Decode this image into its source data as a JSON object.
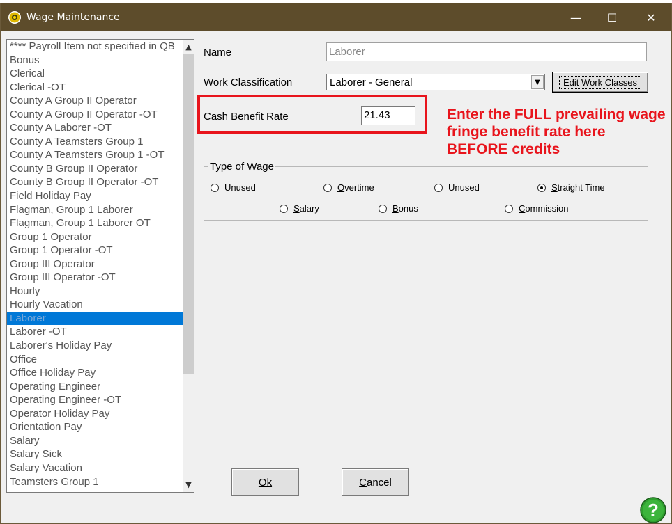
{
  "window": {
    "title": "Wage Maintenance",
    "controls": {
      "minimize": "—",
      "maximize": "☐",
      "close": "✕"
    }
  },
  "payroll_list": {
    "items": [
      "**** Payroll Item not specified in QB",
      "Bonus",
      "Clerical",
      "Clerical -OT",
      "County A Group II Operator",
      "County A Group II Operator -OT",
      "County A Laborer -OT",
      "County A Teamsters Group 1",
      "County A Teamsters Group 1 -OT",
      "County B Group II Operator",
      "County B Group II Operator -OT",
      "Field Holiday Pay",
      "Flagman, Group 1 Laborer",
      "Flagman, Group 1 Laborer OT",
      "Group 1 Operator",
      "Group 1 Operator -OT",
      "Group III Operator",
      "Group III Operator -OT",
      "Hourly",
      "Hourly Vacation",
      "Laborer",
      "Laborer -OT",
      "Laborer's Holiday Pay",
      "Office",
      "Office Holiday Pay",
      "Operating Engineer",
      "Operating Engineer -OT",
      "Operator Holiday Pay",
      "Orientation Pay",
      "Salary",
      "Salary Sick",
      "Salary Vacation",
      "Teamsters Group 1"
    ],
    "selected_index": 20,
    "scroll_up": "▲",
    "scroll_down": "▼"
  },
  "form": {
    "name_label": "Name",
    "name_value": "Laborer",
    "work_class_label": "Work Classification",
    "work_class_value": "Laborer - General",
    "dropdown_arrow": "▼",
    "edit_work_classes": "Edit Work Classes",
    "cash_benefit_label": "Cash Benefit Rate",
    "cash_benefit_value": "21.43"
  },
  "annotation": {
    "text": "Enter the FULL prevailing wage fringe benefit rate here BEFORE credits",
    "color": "#e8141c"
  },
  "type_of_wage": {
    "title": "Type of Wage",
    "options": {
      "unused1": {
        "label": "Unused",
        "checked": false
      },
      "overtime": {
        "label": "Overtime",
        "checked": false
      },
      "unused2": {
        "label": "Unused",
        "checked": false
      },
      "straight_time": {
        "label": "Straight Time",
        "checked": true
      },
      "salary": {
        "label": "Salary",
        "checked": false
      },
      "bonus": {
        "label": "Bonus",
        "checked": false
      },
      "commission": {
        "label": "Commission",
        "checked": false
      }
    }
  },
  "buttons": {
    "ok": "Ok",
    "cancel": "Cancel"
  },
  "colors": {
    "titlebar": "#5d4c2b",
    "selection": "#0078d7",
    "highlight": "#e8141c",
    "help": "#2f9e2f"
  },
  "icons": {
    "app": "sun-icon",
    "help": "help-question-icon"
  }
}
